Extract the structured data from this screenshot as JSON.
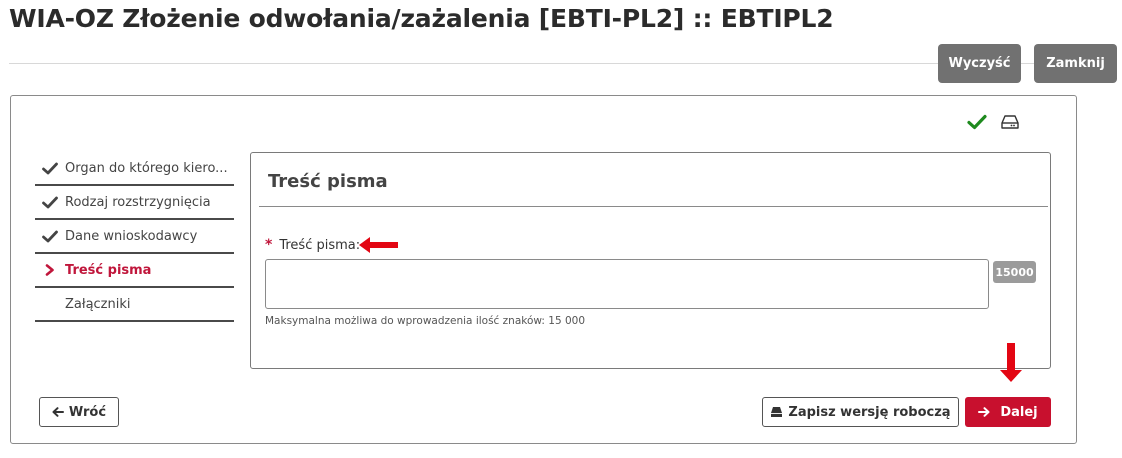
{
  "page": {
    "title": "WIA-OZ Złożenie odwołania/zażalenia [EBTI-PL2] :: EBTIPL2"
  },
  "toolbar": {
    "clear_label": "Wyczyść",
    "close_label": "Zamknij"
  },
  "steps": [
    {
      "label": "Organ do którego kiero...",
      "state": "done",
      "icon": "checkmark-icon"
    },
    {
      "label": "Rodzaj rozstrzygnięcia",
      "state": "done",
      "icon": "checkmark-icon"
    },
    {
      "label": "Dane wnioskodawcy",
      "state": "done",
      "icon": "checkmark-icon"
    },
    {
      "label": "Treść pisma",
      "state": "active",
      "icon": "chevron-right-icon"
    },
    {
      "label": "Załączniki",
      "state": "pending",
      "icon": ""
    }
  ],
  "section": {
    "title": "Treść pisma"
  },
  "field": {
    "required_marker": "*",
    "label": "Treść pisma:",
    "value": "",
    "char_counter": "15000",
    "hint": "Maksymalna możliwa do wprowadzenia ilość znaków: 15 000"
  },
  "footer": {
    "back_label": "Wróć",
    "draft_label": "Zapisz wersję roboczą",
    "next_label": "Dalej"
  },
  "colors": {
    "accent": "#c8102e",
    "active_step": "#c0163b",
    "check": "#1e8a1e",
    "top_button": "#717171",
    "annotation_arrow": "#e30613"
  }
}
